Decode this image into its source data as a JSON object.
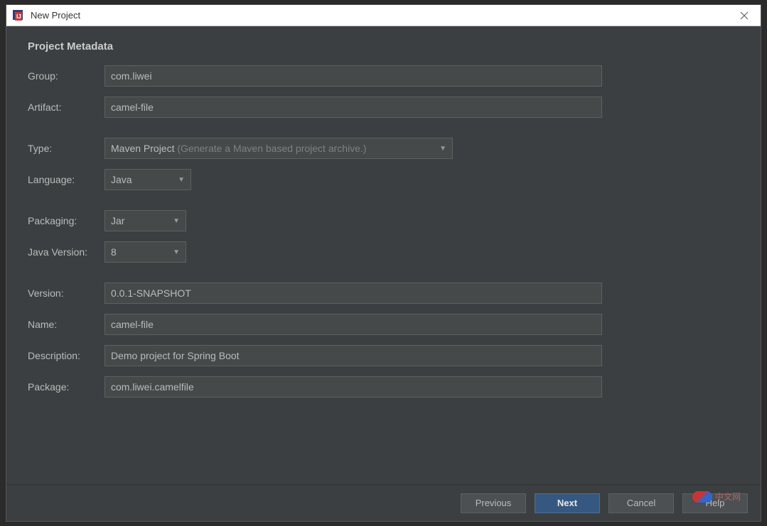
{
  "window": {
    "title": "New Project"
  },
  "section": {
    "heading": "Project Metadata"
  },
  "fields": {
    "group_label": "Group:",
    "group_value": "com.liwei",
    "artifact_label": "Artifact:",
    "artifact_value": "camel-file",
    "type_label": "Type:",
    "type_value": "Maven Project",
    "type_hint": " (Generate a Maven based project archive.)",
    "language_label": "Language:",
    "language_value": "Java",
    "packaging_label": "Packaging:",
    "packaging_value": "Jar",
    "javaversion_label": "Java Version:",
    "javaversion_value": "8",
    "version_label": "Version:",
    "version_value": "0.0.1-SNAPSHOT",
    "name_label": "Name:",
    "name_value": "camel-file",
    "description_label": "Description:",
    "description_value": "Demo project for Spring Boot",
    "package_label": "Package:",
    "package_value": "com.liwei.camelfile"
  },
  "buttons": {
    "previous": "Previous",
    "next": "Next",
    "cancel": "Cancel",
    "help": "Help"
  },
  "watermark": "中文网"
}
